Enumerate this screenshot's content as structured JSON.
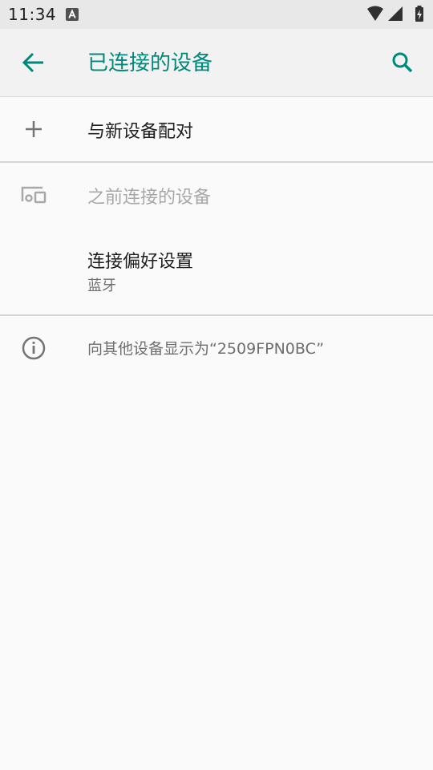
{
  "status_bar": {
    "time": "11:34",
    "notification_icon": "a-box-icon",
    "wifi_icon": "wifi-icon",
    "signal_icon": "cell-signal-icon",
    "battery_icon": "battery-charging-icon"
  },
  "app_bar": {
    "back_icon": "arrow-back-icon",
    "title": "已连接的设备",
    "search_icon": "search-icon"
  },
  "items": {
    "pair_new": {
      "label": "与新设备配对",
      "icon": "plus-icon"
    },
    "previously_connected": {
      "label": "之前连接的设备",
      "icon": "devices-icon"
    },
    "connection_preferences": {
      "label": "连接偏好设置",
      "sublabel": "蓝牙"
    },
    "visible_as": {
      "label": "向其他设备显示为“2509FPN0BC”",
      "icon": "info-icon"
    }
  },
  "colors": {
    "accent": "#00897b",
    "text_primary": "#202020",
    "text_secondary": "#6e6e6e",
    "text_disabled": "#a8a8a8",
    "icon_gray": "#757575"
  }
}
